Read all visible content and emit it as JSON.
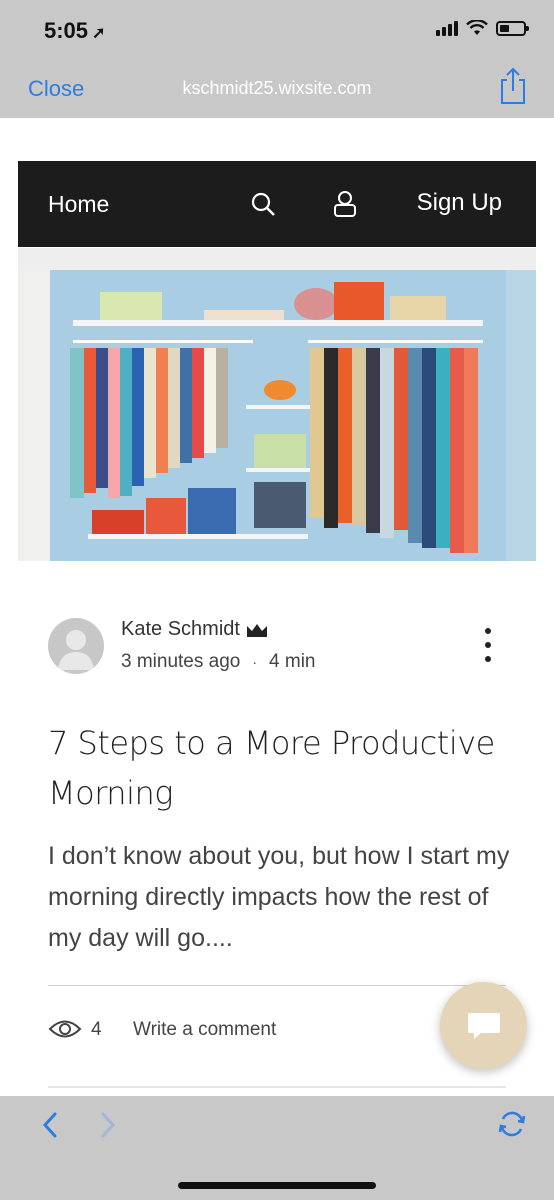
{
  "status_bar": {
    "time": "5:05",
    "battery_level": 0.4
  },
  "browser": {
    "close_label": "Close",
    "url": "kschmidt25.wixsite.com"
  },
  "nav": {
    "home_label": "Home",
    "signup_label": "Sign Up"
  },
  "post": {
    "author": "Kate Schmidt",
    "time_ago": "3 minutes ago",
    "separator": "·",
    "read_time": "4 min",
    "title": "7 Steps to a More Productive Morning",
    "excerpt": "I don’t know about you, but how I start my morning directly impacts how the rest of my day will go....",
    "views": "4",
    "comment_label": "Write a comment"
  },
  "colors": {
    "accent": "#2d7de0",
    "nav_bg": "#1c1c1c",
    "chat_fab": "#e4d4b8",
    "chrome": "#c8c8c8"
  }
}
